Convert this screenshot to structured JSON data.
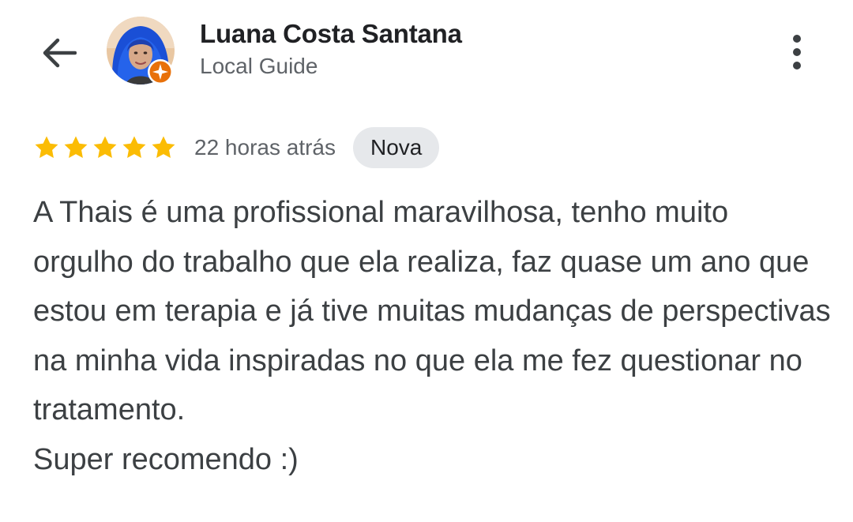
{
  "header": {
    "back_icon": "arrow-back-icon",
    "user_name": "Luana Costa Santana",
    "user_subtitle": "Local Guide",
    "avatar_icon": "profile-photo",
    "badge_icon": "local-guide-badge-icon",
    "more_icon": "more-vert-icon"
  },
  "review": {
    "rating": 5,
    "max_rating": 5,
    "time_ago": "22 horas atrás",
    "badge": "Nova",
    "text": "A Thais é uma profissional maravilhosa, tenho muito orgulho do trabalho que ela realiza, faz quase um ano que estou em terapia e já tive muitas mudanças de perspectivas na minha vida inspiradas no que ela me fez questionar no tratamento.\nSuper recomendo :)"
  },
  "colors": {
    "star": "#fbbc04",
    "badge_bg": "#e6e8eb",
    "guide_badge": "#e8710a",
    "avatar_hair": "#1a4fd6",
    "text_primary": "#202124",
    "text_secondary": "#5f6368"
  }
}
